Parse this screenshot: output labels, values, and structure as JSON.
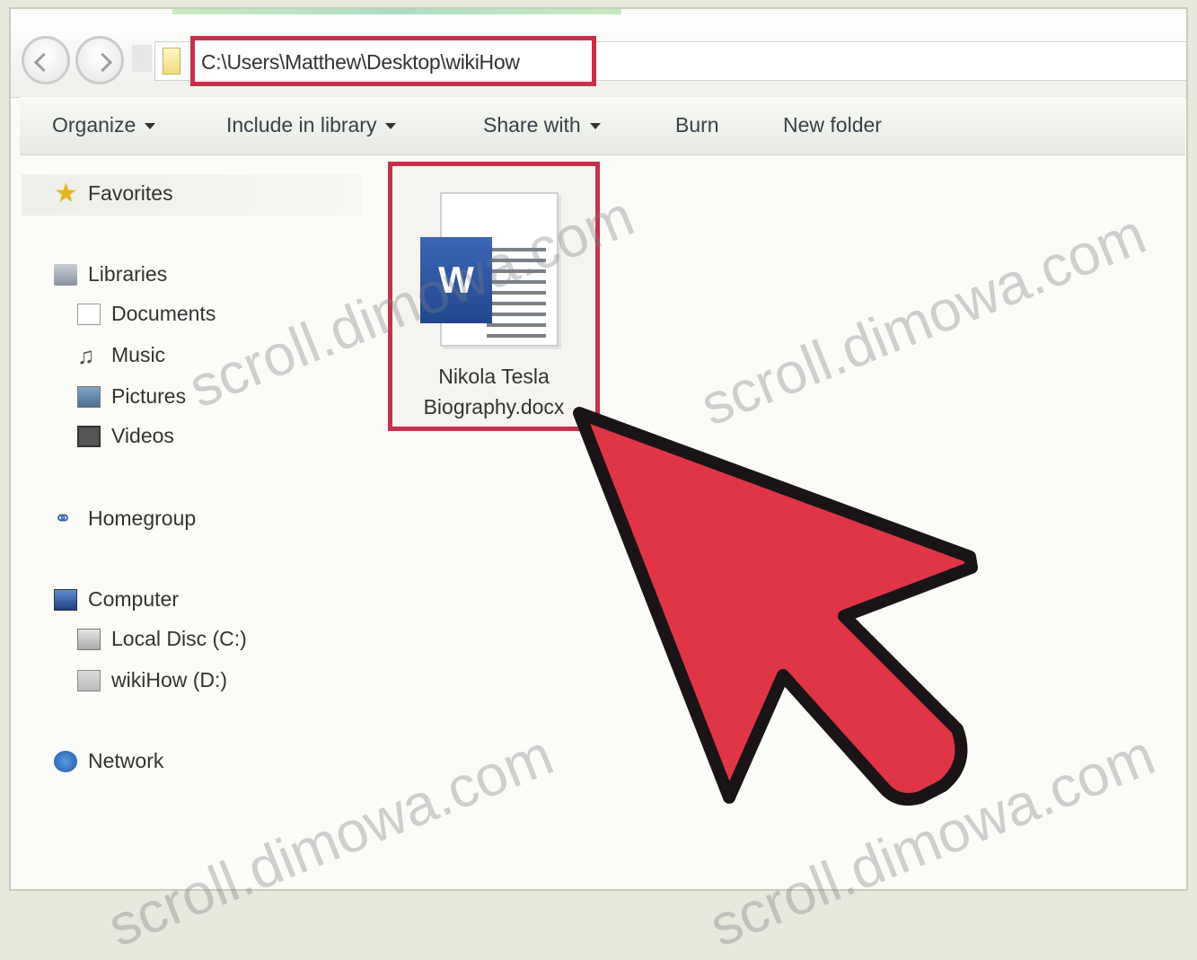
{
  "address_bar": {
    "path": "C:\\Users\\Matthew\\Desktop\\wikiHow"
  },
  "toolbar": {
    "organize": "Organize",
    "include_in_library": "Include in library",
    "share_with": "Share with",
    "burn": "Burn",
    "new_folder": "New folder"
  },
  "sidebar": {
    "favorites": "Favorites",
    "libraries": "Libraries",
    "documents": "Documents",
    "music": "Music",
    "pictures": "Pictures",
    "videos": "Videos",
    "homegroup": "Homegroup",
    "computer": "Computer",
    "local_disc": "Local Disc (C:)",
    "wikihow_drive": "wikiHow (D:)",
    "network": "Network"
  },
  "file": {
    "name_line1": "Nikola Tesla",
    "name_line2": "Biography.docx",
    "icon_letter": "W"
  },
  "watermark": "scroll.dimowa.com",
  "colors": {
    "highlight": "#c8304a",
    "cursor_fill": "#e03545",
    "word_blue": "#2b579a"
  }
}
